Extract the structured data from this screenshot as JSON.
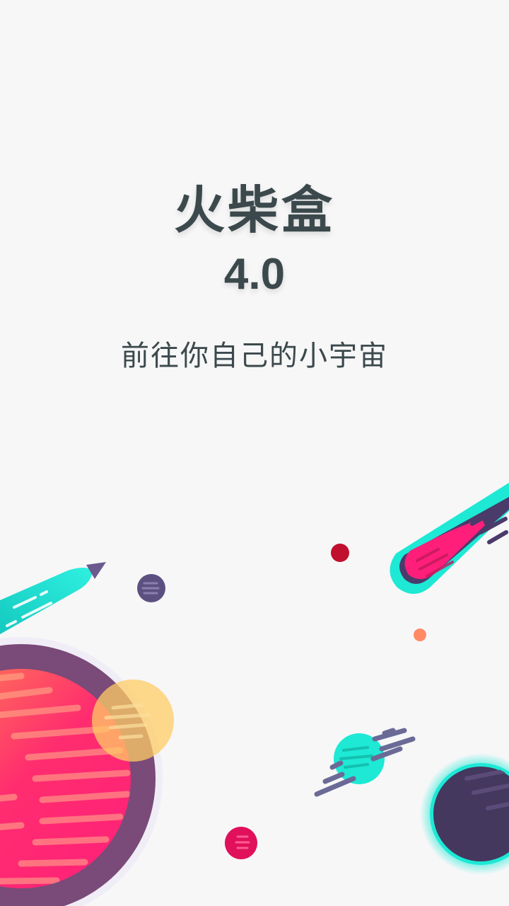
{
  "splash": {
    "app_name": "火柴盒",
    "version": "4.0",
    "tagline": "前往你自己的小宇宙"
  },
  "colors": {
    "background": "#f7f7f8",
    "text": "#3c494c",
    "pink": "#ff1f7a",
    "cyan": "#1de9d5",
    "purple": "#4a3b6b",
    "orange": "#ff8a50",
    "yellow": "#ffcc66",
    "dark_red": "#c0102e"
  },
  "illustration": {
    "elements": [
      "rocket-icon",
      "comet-icon",
      "big-planet-icon",
      "ringed-planet-icon",
      "dark-planet-icon",
      "small-planet-icon"
    ]
  }
}
